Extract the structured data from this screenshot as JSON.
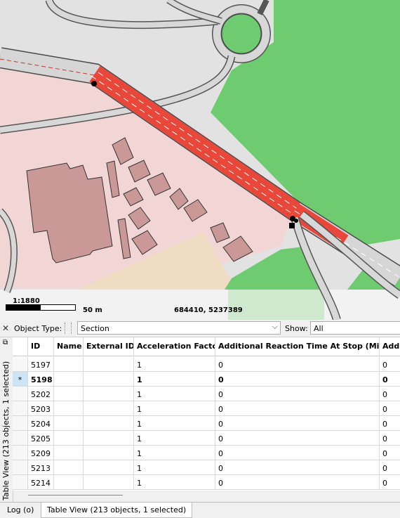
{
  "map": {
    "scale_ratio": "1:1880",
    "scale_distance": "50 m",
    "coordinates": "684410, 5237389",
    "colors": {
      "grass": "#6fcb6f",
      "road_selected": "#e8473a",
      "building": "#c99897",
      "area": "#f2d6d6"
    }
  },
  "toolbar": {
    "close_icon": "close-icon",
    "object_type_label": "Object Type:",
    "object_type_value": "Section",
    "show_label": "Show:",
    "show_value": "All"
  },
  "table": {
    "columns": [
      "ID",
      "Name",
      "External ID",
      "Acceleration Factor",
      "Additional Reaction Time At Stop (Micro)",
      "Addi"
    ],
    "rows": [
      {
        "marker": "",
        "id": "5197",
        "name": "",
        "external_id": "",
        "acceleration": "1",
        "reaction": "0",
        "addi": "0"
      },
      {
        "marker": "*",
        "id": "5198",
        "name": "",
        "external_id": "",
        "acceleration": "1",
        "reaction": "0",
        "addi": "0"
      },
      {
        "marker": "",
        "id": "5202",
        "name": "",
        "external_id": "",
        "acceleration": "1",
        "reaction": "0",
        "addi": "0"
      },
      {
        "marker": "",
        "id": "5203",
        "name": "",
        "external_id": "",
        "acceleration": "1",
        "reaction": "0",
        "addi": "0"
      },
      {
        "marker": "",
        "id": "5204",
        "name": "",
        "external_id": "",
        "acceleration": "1",
        "reaction": "0",
        "addi": "0"
      },
      {
        "marker": "",
        "id": "5205",
        "name": "",
        "external_id": "",
        "acceleration": "1",
        "reaction": "0",
        "addi": "0"
      },
      {
        "marker": "",
        "id": "5209",
        "name": "",
        "external_id": "",
        "acceleration": "1",
        "reaction": "0",
        "addi": "0"
      },
      {
        "marker": "",
        "id": "5213",
        "name": "",
        "external_id": "",
        "acceleration": "1",
        "reaction": "0",
        "addi": "0"
      },
      {
        "marker": "",
        "id": "5214",
        "name": "",
        "external_id": "",
        "acceleration": "1",
        "reaction": "0",
        "addi": "0"
      }
    ],
    "selected_row": 1
  },
  "side_panel": {
    "title": "Table View (213 objects, 1 selected)"
  },
  "bottom_tabs": [
    {
      "label": "Log (o)",
      "active": false
    },
    {
      "label": "Table View (213 objects, 1 selected)",
      "active": true
    }
  ]
}
